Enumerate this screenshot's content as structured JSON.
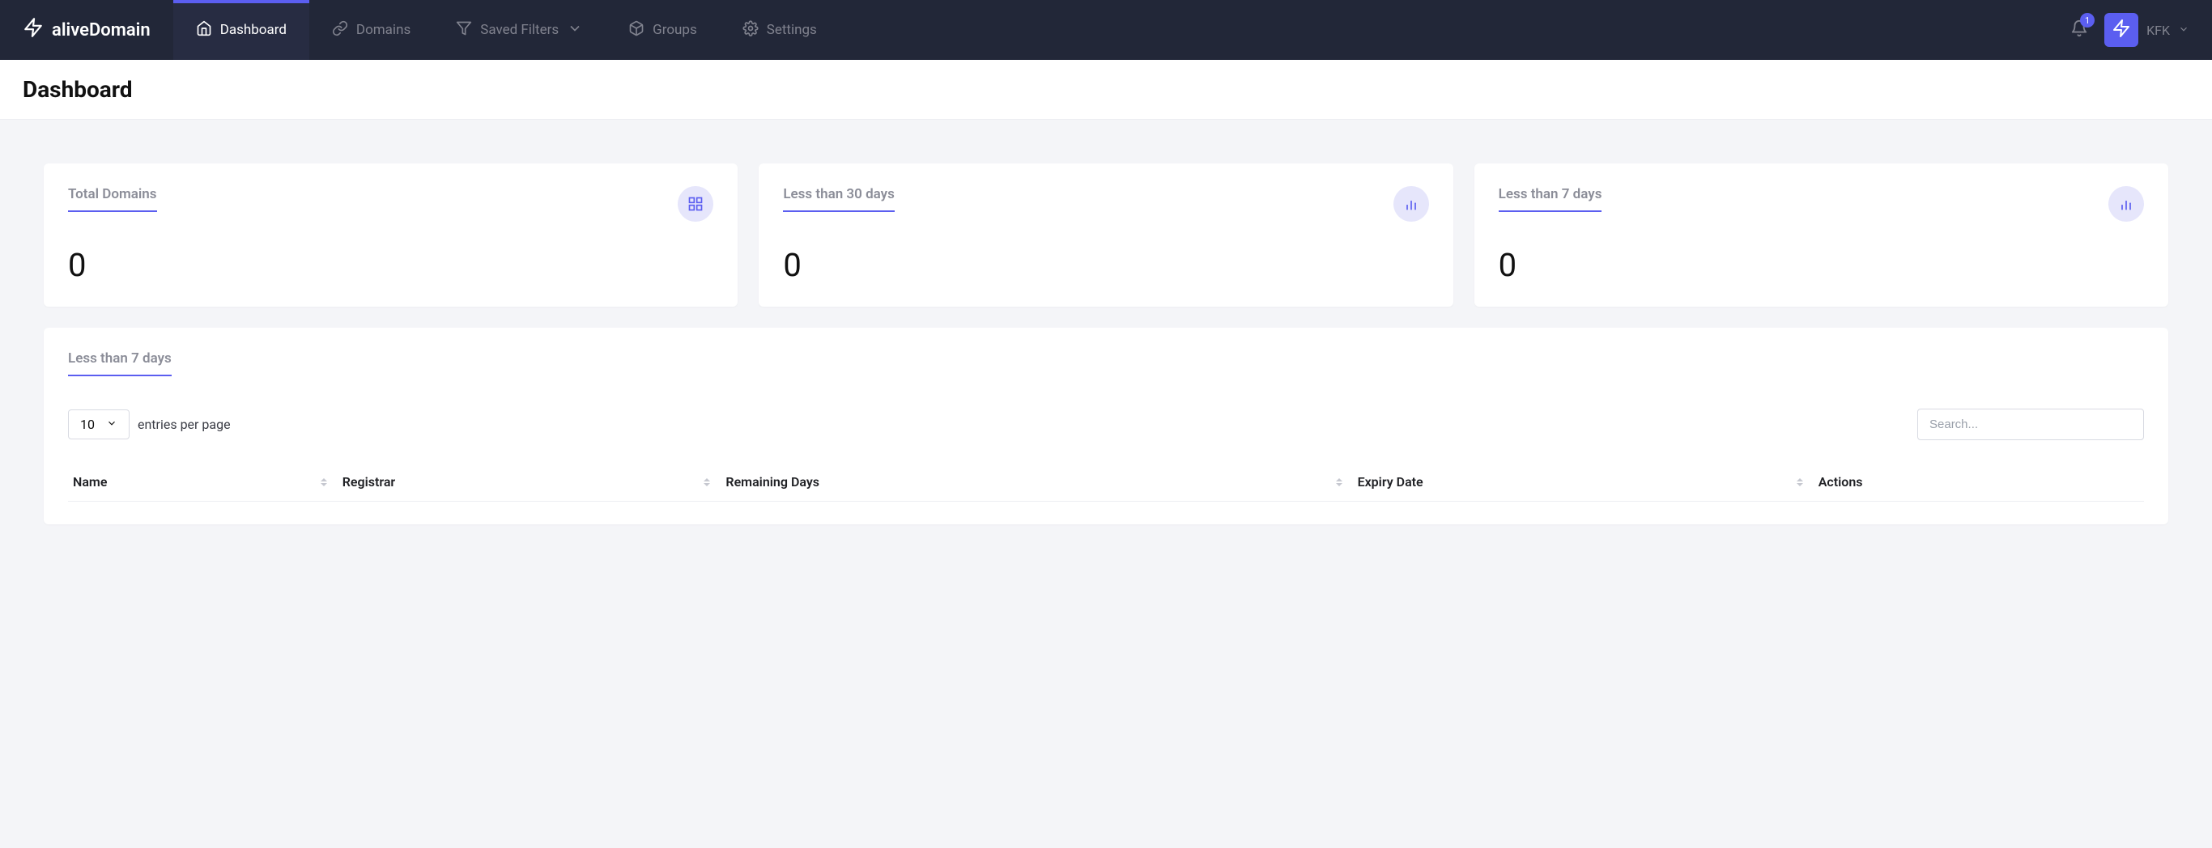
{
  "brand": {
    "name": "aliveDomain"
  },
  "nav": {
    "items": [
      {
        "label": "Dashboard",
        "active": true
      },
      {
        "label": "Domains",
        "active": false
      },
      {
        "label": "Saved Filters",
        "active": false,
        "hasChevron": true
      },
      {
        "label": "Groups",
        "active": false
      },
      {
        "label": "Settings",
        "active": false
      }
    ]
  },
  "notifications": {
    "count": "1"
  },
  "user": {
    "initials": "KFK"
  },
  "page": {
    "title": "Dashboard"
  },
  "cards": [
    {
      "title": "Total Domains",
      "value": "0"
    },
    {
      "title": "Less than 30 days",
      "value": "0"
    },
    {
      "title": "Less than 7 days",
      "value": "0"
    }
  ],
  "panel": {
    "title": "Less than 7 days",
    "entriesValue": "10",
    "entriesLabel": "entries per page",
    "searchPlaceholder": "Search...",
    "columns": [
      {
        "label": "Name",
        "sortable": true
      },
      {
        "label": "Registrar",
        "sortable": true
      },
      {
        "label": "Remaining Days",
        "sortable": true
      },
      {
        "label": "Expiry Date",
        "sortable": true
      },
      {
        "label": "Actions",
        "sortable": false
      }
    ]
  }
}
